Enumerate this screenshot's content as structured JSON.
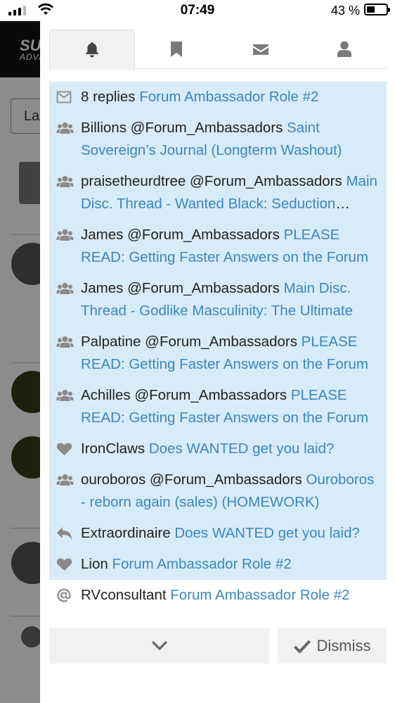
{
  "status_bar": {
    "time": "07:49",
    "battery_text": "43 %",
    "battery_level": 0.43
  },
  "background": {
    "logo": "SU",
    "logo_sub": "ADVA",
    "language_label": "La"
  },
  "tabs": [
    {
      "icon": "bell-icon",
      "active": true
    },
    {
      "icon": "bookmark-icon",
      "active": false
    },
    {
      "icon": "envelope-icon",
      "active": false
    },
    {
      "icon": "user-icon",
      "active": false
    }
  ],
  "notifications": [
    {
      "icon": "envelope-icon",
      "user": "8 replies",
      "link": "Forum Ambassador Role #2",
      "unread": true
    },
    {
      "icon": "group-icon",
      "user": "Billions @Forum_Ambassadors",
      "link": "Saint Sovereign’s Journal (Longterm Washout)",
      "unread": true
    },
    {
      "icon": "group-icon",
      "user": "praisetheurdtree @Forum_Ambassadors",
      "link": "Main Disc. Thread - Wanted Black: Seduction Mastery",
      "unread": true
    },
    {
      "icon": "group-icon",
      "user": "James @Forum_Ambassadors",
      "link": "PLEASE READ: Getting Faster Answers on the Forum",
      "unread": true
    },
    {
      "icon": "group-icon",
      "user": "James @Forum_Ambassadors",
      "link": "Main Disc. Thread - Godlike Masculinity: The Ultimate",
      "unread": true
    },
    {
      "icon": "group-icon",
      "user": "Palpatine @Forum_Ambassadors",
      "link": "PLEASE READ: Getting Faster Answers on the Forum",
      "unread": true
    },
    {
      "icon": "group-icon",
      "user": "Achilles @Forum_Ambassadors",
      "link": "PLEASE READ: Getting Faster Answers on the Forum",
      "unread": true
    },
    {
      "icon": "heart-icon",
      "user": "IronClaws",
      "link": "Does WANTED get you laid?",
      "unread": true
    },
    {
      "icon": "group-icon",
      "user": "ouroboros @Forum_Ambassadors",
      "link": "Ouroboros - reborn again (sales) (HOMEWORK)",
      "unread": true
    },
    {
      "icon": "reply-icon",
      "user": "Extraordinaire",
      "link": "Does WANTED get you laid?",
      "unread": true
    },
    {
      "icon": "heart-icon",
      "user": "Lion",
      "link": "Forum Ambassador Role #2",
      "unread": true
    },
    {
      "icon": "at-icon",
      "user": "RVconsultant",
      "link": "Forum Ambassador Role #2",
      "unread": false
    }
  ],
  "footer": {
    "more_icon": "chevron-down-icon",
    "dismiss_label": "Dismiss"
  }
}
